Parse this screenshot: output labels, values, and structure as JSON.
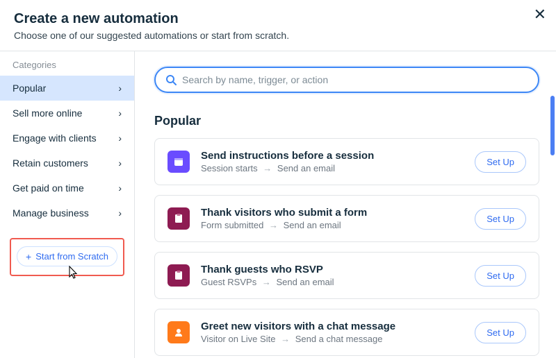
{
  "header": {
    "title": "Create a new automation",
    "subtitle": "Choose one of our suggested automations or start from scratch."
  },
  "sidebar": {
    "heading": "Categories",
    "items": [
      {
        "label": "Popular",
        "active": true
      },
      {
        "label": "Sell more online",
        "active": false
      },
      {
        "label": "Engage with clients",
        "active": false
      },
      {
        "label": "Retain customers",
        "active": false
      },
      {
        "label": "Get paid on time",
        "active": false
      },
      {
        "label": "Manage business",
        "active": false
      }
    ],
    "scratch_label": "Start from Scratch"
  },
  "search": {
    "placeholder": "Search by name, trigger, or action"
  },
  "section": {
    "heading": "Popular"
  },
  "cards": [
    {
      "title": "Send instructions before a session",
      "trigger": "Session starts",
      "action": "Send an email",
      "setup": "Set Up",
      "icon": "calendar",
      "color": "purple"
    },
    {
      "title": "Thank visitors who submit a form",
      "trigger": "Form submitted",
      "action": "Send an email",
      "setup": "Set Up",
      "icon": "clipboard",
      "color": "crimson"
    },
    {
      "title": "Thank guests who RSVP",
      "trigger": "Guest RSVPs",
      "action": "Send an email",
      "setup": "Set Up",
      "icon": "clipboard",
      "color": "crimson"
    },
    {
      "title": "Greet new visitors with a chat message",
      "trigger": "Visitor on Live Site",
      "action": "Send a chat message",
      "setup": "Set Up",
      "icon": "chat",
      "color": "orange"
    }
  ]
}
